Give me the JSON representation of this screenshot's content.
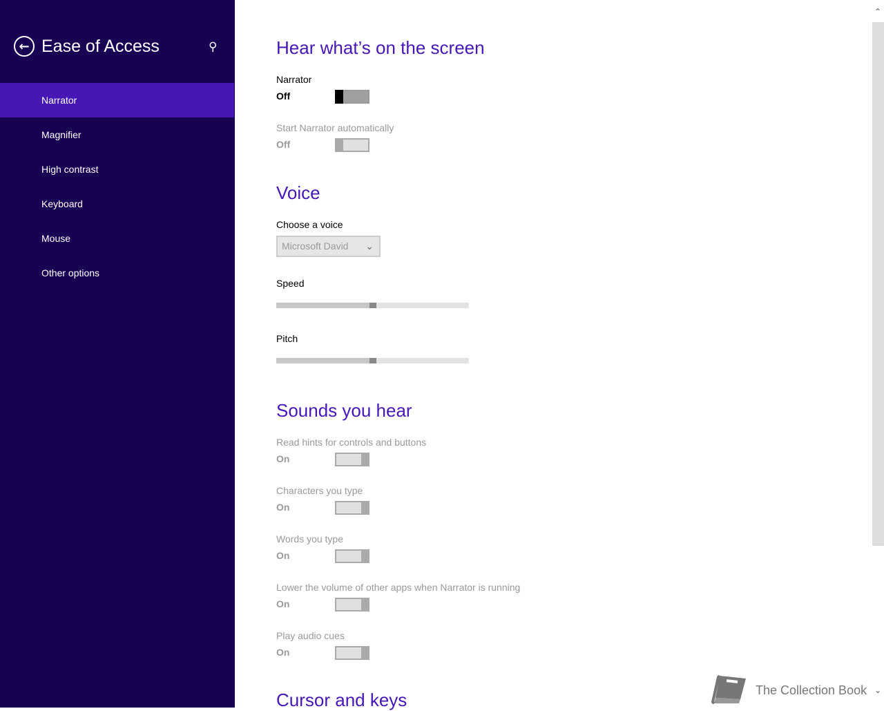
{
  "sidebar": {
    "title": "Ease of Access",
    "back_icon": "back-arrow-icon",
    "search_icon": "search-icon",
    "items": [
      {
        "label": "Narrator",
        "selected": true
      },
      {
        "label": "Magnifier"
      },
      {
        "label": "High contrast"
      },
      {
        "label": "Keyboard"
      },
      {
        "label": "Mouse"
      },
      {
        "label": "Other options"
      }
    ]
  },
  "main": {
    "hear": {
      "heading": "Hear what’s on the screen",
      "narrator": {
        "label": "Narrator",
        "state": "Off"
      },
      "auto": {
        "label": "Start Narrator automatically",
        "state": "Off"
      }
    },
    "voice": {
      "heading": "Voice",
      "choose_label": "Choose a voice",
      "choose_value": "Microsoft David",
      "speed": {
        "label": "Speed",
        "value_percent": 50
      },
      "pitch": {
        "label": "Pitch",
        "value_percent": 50
      }
    },
    "sounds": {
      "heading": "Sounds you hear",
      "items": [
        {
          "label": "Read hints for controls and buttons",
          "state": "On"
        },
        {
          "label": "Characters you type",
          "state": "On"
        },
        {
          "label": "Words you type",
          "state": "On"
        },
        {
          "label": "Lower the volume of other apps when Narrator is running",
          "state": "On"
        },
        {
          "label": "Play audio cues",
          "state": "On"
        }
      ]
    },
    "cursor": {
      "heading": "Cursor and keys"
    }
  },
  "watermark": {
    "text": "The Collection Book"
  },
  "colors": {
    "sidebar": "#180052",
    "accent": "#4617b4"
  }
}
